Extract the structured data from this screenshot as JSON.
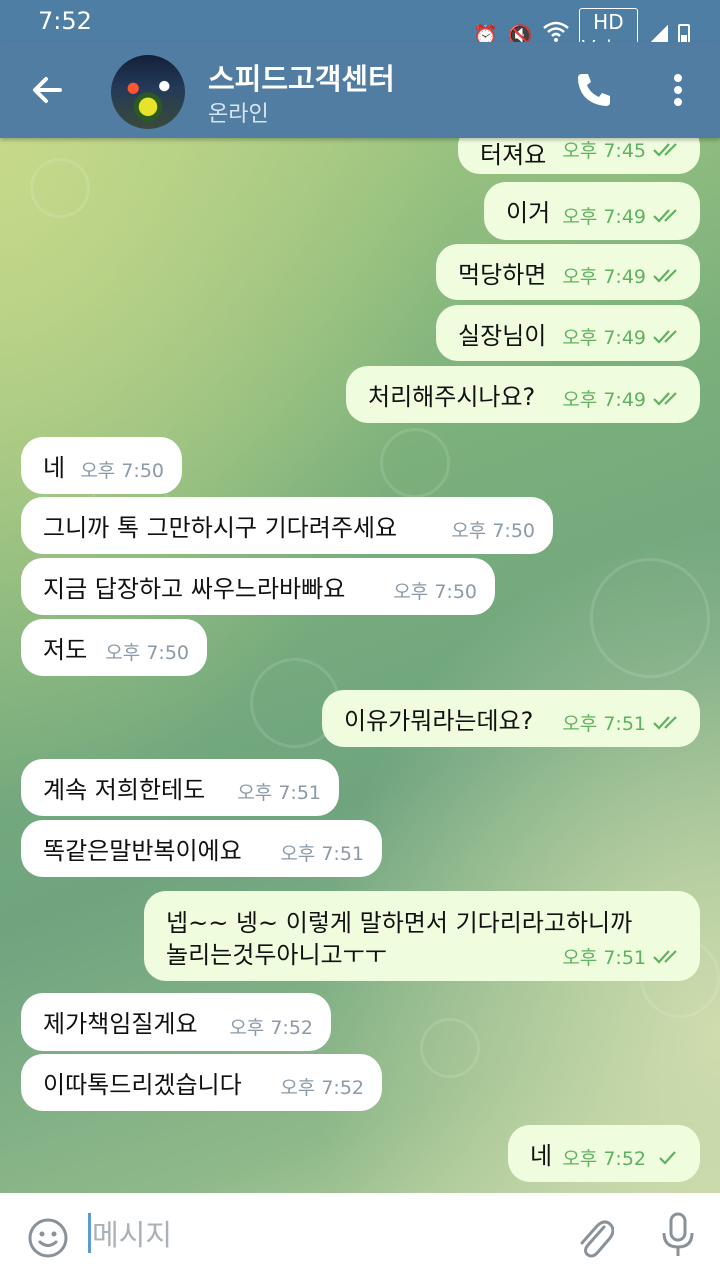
{
  "status_bar": {
    "time": "7:52",
    "icons": [
      "alarm-icon",
      "mute-icon",
      "wifi-icon",
      "hd-voice-icon",
      "signal-icon",
      "battery-icon"
    ],
    "hd_label": "HD",
    "voice_label": "Voice"
  },
  "header": {
    "title": "스피드고객센터",
    "subtitle": "온라인"
  },
  "messages": [
    {
      "dir": "out",
      "text": "터져요",
      "time": "오후 7:45",
      "status": "read"
    },
    {
      "dir": "out",
      "text": "이거",
      "time": "오후 7:49",
      "status": "read"
    },
    {
      "dir": "out",
      "text": "먹당하면",
      "time": "오후 7:49",
      "status": "read"
    },
    {
      "dir": "out",
      "text": "실장님이",
      "time": "오후 7:49",
      "status": "read"
    },
    {
      "dir": "out",
      "text": "처리해주시나요?",
      "time": "오후 7:49",
      "status": "read"
    },
    {
      "dir": "in",
      "text": "네",
      "time": "오후 7:50"
    },
    {
      "dir": "in",
      "text": "그니까 톡 그만하시구 기다려주세요",
      "time": "오후 7:50"
    },
    {
      "dir": "in",
      "text": "지금 답장하고 싸우느라바빠요",
      "time": "오후 7:50"
    },
    {
      "dir": "in",
      "text": "저도",
      "time": "오후 7:50"
    },
    {
      "dir": "out",
      "text": "이유가뭐라는데요?",
      "time": "오후 7:51",
      "status": "read"
    },
    {
      "dir": "in",
      "text": "계속 저희한테도",
      "time": "오후 7:51"
    },
    {
      "dir": "in",
      "text": "똑같은말반복이에요",
      "time": "오후 7:51"
    },
    {
      "dir": "out",
      "text": "넵~~ 넹~ 이렇게 말하면서 기다리라고하니까",
      "text2": "놀리는것두아니고ㅜㅜ",
      "time": "오후 7:51",
      "status": "read"
    },
    {
      "dir": "in",
      "text": "제가책임질게요",
      "time": "오후 7:52"
    },
    {
      "dir": "in",
      "text": "이따톡드리겠습니다",
      "time": "오후 7:52"
    },
    {
      "dir": "out",
      "text": "네",
      "time": "오후 7:52",
      "status": "sent"
    }
  ],
  "input": {
    "placeholder": "메시지"
  },
  "colors": {
    "header": "#517da2",
    "outgoing_bubble": "#effdde",
    "incoming_bubble": "#ffffff",
    "time_out": "#5fb25f",
    "time_in": "#8b9aa8"
  }
}
